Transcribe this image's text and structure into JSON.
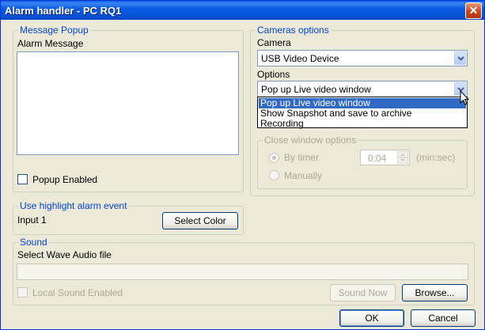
{
  "window": {
    "title": "Alarm handler - PC RQ1",
    "close_glyph": "✕"
  },
  "message_popup": {
    "legend": "Message Popup",
    "alarm_message_label": "Alarm Message",
    "alarm_message_value": "",
    "popup_enabled_label": "Popup Enabled",
    "popup_enabled": false
  },
  "cameras": {
    "legend": "Cameras options",
    "camera_label": "Camera",
    "camera_value": "USB Video Device",
    "options_label": "Options",
    "options_value": "Pop up Live video window",
    "options_list": [
      "Pop up Live video window",
      "Show Snapshot and save to archive",
      "Recording"
    ],
    "options_selected_index": 0
  },
  "close_window": {
    "legend": "Close window options",
    "by_timer_label": "By timer",
    "timer_value": "0:04",
    "timer_unit": "(min:sec)",
    "manually_label": "Manually",
    "selected": "By timer"
  },
  "highlight": {
    "legend": "Use highlight alarm event",
    "input_label": "Input 1",
    "select_color_label": "Select Color"
  },
  "sound": {
    "legend": "Sound",
    "select_wave_label": "Select Wave Audio file",
    "wave_file_value": "",
    "local_sound_label": "Local Sound Enabled",
    "local_sound_enabled": false,
    "sound_now_label": "Sound Now",
    "browse_label": "Browse..."
  },
  "footer": {
    "ok_label": "OK",
    "cancel_label": "Cancel"
  },
  "colors": {
    "title_blue": "#0a5de6",
    "legend_blue": "#0046d5",
    "selection": "#316ac5",
    "dialog_bg": "#ece9d8"
  },
  "icons": {
    "close": "close-icon",
    "dropdown": "chevron-down-icon",
    "cursor": "mouse-pointer-icon"
  }
}
